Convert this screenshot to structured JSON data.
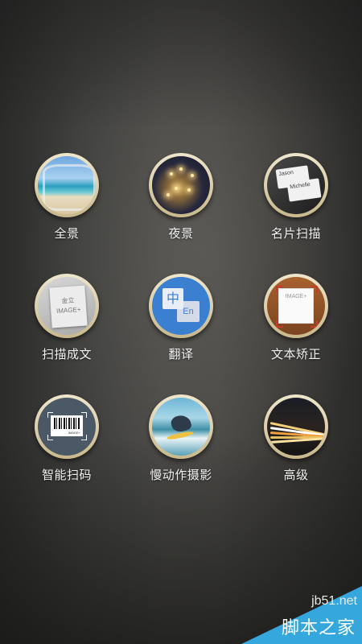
{
  "modes": [
    {
      "label": "全景",
      "icon": "panorama-icon"
    },
    {
      "label": "夜景",
      "icon": "night-scene-icon"
    },
    {
      "label": "名片扫描",
      "icon": "business-card-scan-icon",
      "card_front_text": "Jason",
      "card_back_text": "Michelle"
    },
    {
      "label": "扫描成文",
      "icon": "document-scan-icon",
      "page_text_1": "金立",
      "page_text_2": "IMAGE+"
    },
    {
      "label": "翻译",
      "icon": "translate-icon",
      "tile_zh": "中",
      "tile_en": "En"
    },
    {
      "label": "文本矫正",
      "icon": "text-correction-icon",
      "doc_text": "IMAGE+"
    },
    {
      "label": "智能扫码",
      "icon": "barcode-scan-icon",
      "tag_text": "IMAGE+"
    },
    {
      "label": "慢动作摄影",
      "icon": "slow-motion-icon"
    },
    {
      "label": "高级",
      "icon": "advanced-icon"
    }
  ],
  "watermark": {
    "site": "jb51.net",
    "name": "脚本之家"
  }
}
